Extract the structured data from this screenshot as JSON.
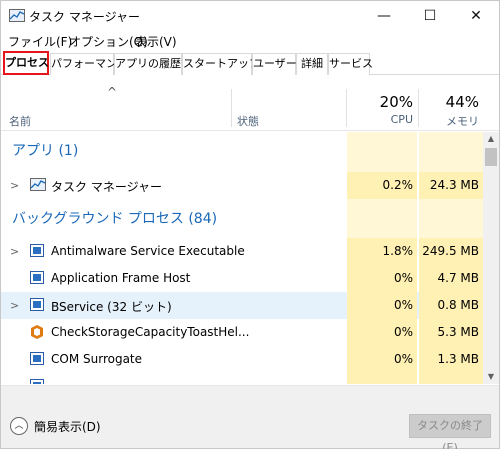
{
  "window": {
    "title": "タスク マネージャー",
    "buttons": {
      "minimize": "—",
      "maximize": "☐",
      "close": "✕"
    }
  },
  "menu": [
    "ファイル(F)",
    "オプション(O)",
    "表示(V)"
  ],
  "tabs": [
    {
      "label": "プロセス",
      "active": true
    },
    {
      "label": "パフォーマンス"
    },
    {
      "label": "アプリの履歴"
    },
    {
      "label": "スタートアップ"
    },
    {
      "label": "ユーザー"
    },
    {
      "label": "詳細"
    },
    {
      "label": "サービス"
    }
  ],
  "header": {
    "sort_arrow": "^",
    "name": "名前",
    "status": "状態",
    "cpu_pct": "20%",
    "cpu": "CPU",
    "mem_pct": "44%",
    "mem": "メモリ"
  },
  "groups": {
    "apps": "アプリ (1)",
    "background": "バックグラウンド プロセス (84)"
  },
  "processes": [
    {
      "name": "タスク マネージャー",
      "cpu": "0.2%",
      "mem": "24.3 MB",
      "expand": true,
      "icon": "task-manager-icon"
    },
    {
      "name": "Antimalware Service Executable",
      "cpu": "1.8%",
      "mem": "249.5 MB",
      "expand": true,
      "icon": "service-icon"
    },
    {
      "name": "Application Frame Host",
      "cpu": "0%",
      "mem": "4.7 MB",
      "expand": false,
      "icon": "service-icon"
    },
    {
      "name": "BService (32 ビット)",
      "cpu": "0%",
      "mem": "0.8 MB",
      "expand": true,
      "selected": true,
      "icon": "service-icon"
    },
    {
      "name": "CheckStorageCapacityToastHel...",
      "cpu": "0%",
      "mem": "5.3 MB",
      "expand": false,
      "icon": "orange-app-icon"
    },
    {
      "name": "COM Surrogate",
      "cpu": "0%",
      "mem": "1.3 MB",
      "expand": false,
      "icon": "service-icon"
    }
  ],
  "footer": {
    "simple_view": "簡易表示(D)",
    "end_task": "タスクの終了(E)"
  },
  "colors": {
    "highlight": "#fff0b3",
    "group_text": "#1a68b8",
    "active_tab_border": "#e8141c",
    "selected_row": "#e5f1fb"
  }
}
